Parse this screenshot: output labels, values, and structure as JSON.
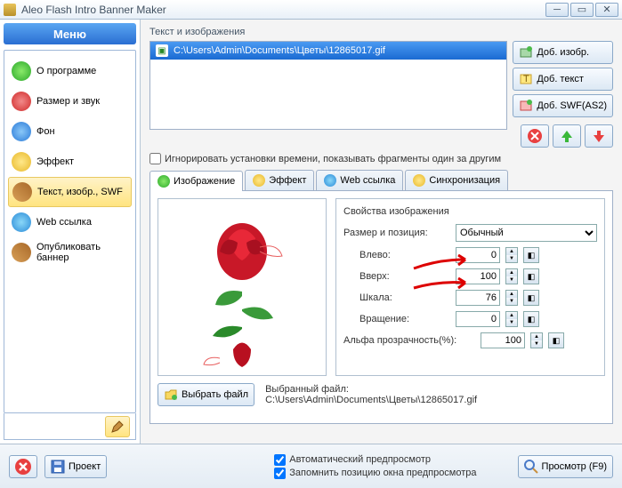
{
  "window": {
    "title": "Aleo Flash Intro Banner Maker"
  },
  "menu": {
    "header": "Меню",
    "items": [
      "О программе",
      "Размер и звук",
      "Фон",
      "Эффект",
      "Текст, изобр., SWF",
      "Web ссылка",
      "Опубликовать баннер"
    ]
  },
  "section": {
    "title": "Текст и изображения"
  },
  "filelist": {
    "item0": "C:\\Users\\Admin\\Documents\\Цветы\\12865017.gif"
  },
  "buttons": {
    "add_image": "Доб. изобр.",
    "add_text": "Доб. текст",
    "add_swf": "Доб. SWF(AS2)",
    "choose_file": "Выбрать файл",
    "project": "Проект",
    "preview": "Просмотр (F9)"
  },
  "checks": {
    "ignore_time": "Игнорировать установки времени, показывать фрагменты один за другим",
    "auto_preview": "Автоматический предпросмотр",
    "remember_pos": "Запомнить позицию окна предпросмотра"
  },
  "tabs": {
    "image": "Изображение",
    "effect": "Эффект",
    "web": "Web ссылка",
    "sync": "Синхронизация"
  },
  "props": {
    "heading": "Свойства изображения",
    "size_pos": "Размер и позиция:",
    "size_mode": "Обычный",
    "left": "Влево:",
    "top": "Вверх:",
    "scale": "Шкала:",
    "rotation": "Вращение:",
    "alpha": "Альфа прозрачность(%):",
    "vals": {
      "left": "0",
      "top": "100",
      "scale": "76",
      "rotation": "0",
      "alpha": "100"
    }
  },
  "selected": {
    "label": "Выбранный файл:",
    "path": "C:\\Users\\Admin\\Documents\\Цветы\\12865017.gif"
  }
}
